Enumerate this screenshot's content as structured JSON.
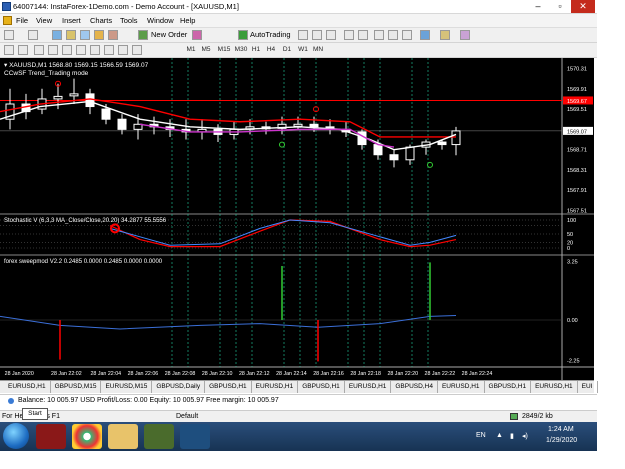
{
  "window": {
    "title": "64007144: InstaForex-1Demo.com - Demo Account - [XAUUSD,M1]",
    "min": "–",
    "max": "▫",
    "close": "✕"
  },
  "menu": [
    "File",
    "View",
    "Insert",
    "Charts",
    "Tools",
    "Window",
    "Help"
  ],
  "toolbar": {
    "new_order": "New Order",
    "auto_trading": "AutoTrading",
    "timeframes": [
      "M1",
      "M5",
      "M15",
      "M30",
      "H1",
      "H4",
      "D1",
      "W1",
      "MN"
    ]
  },
  "chart": {
    "header": "▾ XAUUSD,M1  1568.80 1569.15 1566.59 1569.07",
    "indicator_label": "CCwSF Trend_Trading mode",
    "stoch_label": "Stochastic V (6,3,3 MA_Close/Close,20.20) 34.2877 55.5556",
    "forex_label": "forex sweepmod V2.2 0.2485 0.0000 0.2485 0.0000 0.0000",
    "price_ticks": [
      "1570.31",
      "1569.91",
      "1569.51",
      "1569.07",
      "1568.71",
      "1568.31",
      "1567.91",
      "1567.51"
    ],
    "price_red": "1569.67",
    "stoch_ticks": [
      "100",
      "50",
      "20",
      "0"
    ],
    "forex_ticks": [
      "3.25",
      "0.00",
      "-2.25"
    ],
    "time_labels": [
      "28 Jan 2020",
      "28 Jan 22:02",
      "28 Jan 22:04",
      "28 Jan 22:06",
      "28 Jan 22:08",
      "28 Jan 22:10",
      "28 Jan 22:12",
      "28 Jan 22:14",
      "28 Jan 22:16",
      "28 Jan 22:18",
      "28 Jan 22:20",
      "28 Jan 22:22",
      "28 Jan 22:24"
    ]
  },
  "tabs": [
    "EURUSD,H1",
    "GBPUSD,M15",
    "EURUSD,M15",
    "GBPUSD,Daily",
    "GBPUSD,H1",
    "EURUSD,H1",
    "GBPUSD,H1",
    "EURUSD,H1",
    "GBPUSD,H4",
    "EURUSD,H1",
    "GBPUSD,H1",
    "EURUSD,H1",
    "EUI"
  ],
  "balance": "Balance: 10 005.97 USD  Profit/Loss: 0.00  Equity: 10 005.97  Free margin: 10 005.97",
  "status": {
    "help": "For Help, press F1",
    "profile": "Default",
    "traffic": "2849/2 kb"
  },
  "tooltip": "Start",
  "tray": {
    "lang": "EN",
    "time": "1:24 AM",
    "date": "1/29/2020"
  },
  "colors": {
    "bg": "#000000",
    "bull": "#ffffff",
    "bear": "#ffffff",
    "red_line": "#ff0000",
    "white_line": "#ffffff",
    "purple": "#cc33cc",
    "green": "#33cc33",
    "blue": "#3366ff",
    "grid": "#20d0a0"
  }
}
